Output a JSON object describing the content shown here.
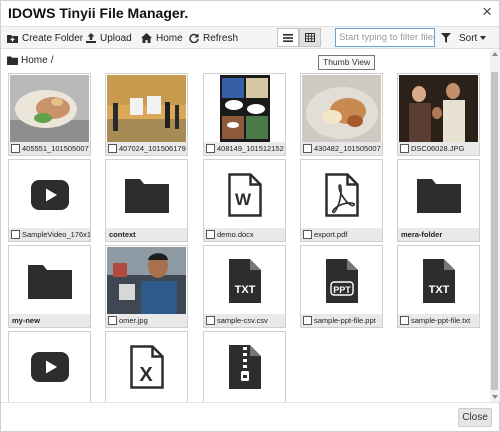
{
  "window": {
    "title": "IDOWS Tinyii File Manager.",
    "close_symbol": "×"
  },
  "toolbar": {
    "create_folder": "Create Folder",
    "upload": "Upload",
    "home": "Home",
    "refresh": "Refresh",
    "filter_placeholder": "Start typing to filter files.",
    "sort": "Sort",
    "view_mode": "thumb"
  },
  "breadcrumb": {
    "label": "Home",
    "separator": "/"
  },
  "tooltip": "Thumb View",
  "files": [
    {
      "name": "405551_101505007",
      "type": "image",
      "icon": "photo-burrito"
    },
    {
      "name": "407024_101506179",
      "type": "image",
      "icon": "photo-stage"
    },
    {
      "name": "408149_101512152",
      "type": "image",
      "icon": "photo-comic"
    },
    {
      "name": "430482_101505007",
      "type": "image",
      "icon": "photo-food"
    },
    {
      "name": "DSC06028.JPG",
      "type": "image",
      "icon": "photo-people"
    },
    {
      "name": "SampleVideo_176x1",
      "type": "video",
      "icon": "video-icon"
    },
    {
      "name": "context",
      "type": "folder",
      "icon": "folder-icon"
    },
    {
      "name": "demo.docx",
      "type": "word",
      "icon": "word-doc-icon"
    },
    {
      "name": "export.pdf",
      "type": "pdf",
      "icon": "pdf-icon"
    },
    {
      "name": "mera-folder",
      "type": "folder",
      "icon": "folder-icon"
    },
    {
      "name": "my-new",
      "type": "folder",
      "icon": "folder-icon"
    },
    {
      "name": "omer.jpg",
      "type": "image",
      "icon": "photo-person"
    },
    {
      "name": "sample-csv.csv",
      "type": "txt",
      "icon": "txt-file-icon",
      "icon_text": "TXT"
    },
    {
      "name": "sample-ppt-file.ppt",
      "type": "ppt",
      "icon": "ppt-file-icon",
      "icon_text": "PPT"
    },
    {
      "name": "sample-ppt-file.txt",
      "type": "txt",
      "icon": "txt-file-icon",
      "icon_text": "TXT"
    },
    {
      "name": "",
      "type": "video",
      "icon": "video-icon"
    },
    {
      "name": "",
      "type": "excel",
      "icon": "excel-file-icon",
      "icon_text": "X"
    },
    {
      "name": "",
      "type": "zip",
      "icon": "zip-file-icon"
    }
  ],
  "footer": {
    "close": "Close"
  },
  "colors": {
    "icon": "#2d2d2d",
    "caption_bg": "#e9e9e9",
    "accent": "#6aa2d8"
  }
}
